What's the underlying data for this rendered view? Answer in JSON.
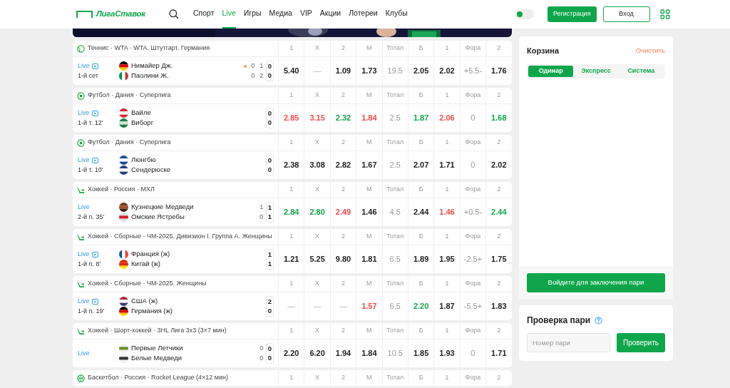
{
  "header": {
    "logo": "ЛигаСтавок",
    "nav": [
      {
        "label": "Спорт",
        "selected": false
      },
      {
        "label": "Live",
        "selected": true
      },
      {
        "label": "Игры",
        "selected": false
      },
      {
        "label": "Медиа",
        "selected": false
      },
      {
        "label": "VIP",
        "selected": false
      },
      {
        "label": "Акции",
        "selected": false
      },
      {
        "label": "Лотереи",
        "selected": false
      },
      {
        "label": "Клубы",
        "selected": false
      }
    ],
    "theme_switch": {
      "on": false
    },
    "register": "Регистрация",
    "login": "Вход"
  },
  "events": [
    {
      "kind": "tennis",
      "title": "Теннис · WTA · WTA. Штутгарт. Германия",
      "columns": [
        "1",
        "X",
        "2",
        "М",
        "Тотал",
        "Б",
        "1",
        "Фора",
        "2"
      ],
      "live": "Live",
      "video": true,
      "period": "1-й сет",
      "teams": [
        {
          "name": "Нимайер Дж.",
          "serving": true,
          "scores": [
            "0",
            "1"
          ],
          "current": "0"
        },
        {
          "name": "Паолини Ж.",
          "serving": false,
          "scores": [
            "0",
            "2"
          ],
          "current": "0"
        }
      ],
      "odds": [
        {
          "v": "5.40",
          "kind": "plain"
        },
        {
          "v": "—",
          "kind": "dash"
        },
        {
          "v": "1.09",
          "kind": "plain"
        },
        {
          "v": "1.73",
          "kind": "plain"
        },
        {
          "v": "19.5",
          "kind": "param"
        },
        {
          "v": "2.05",
          "kind": "plain"
        },
        {
          "v": "2.02",
          "kind": "plain"
        },
        {
          "v": "+5.5-",
          "kind": "param"
        },
        {
          "v": "1.76",
          "kind": "plain"
        }
      ]
    },
    {
      "kind": "football",
      "title": "Футбол · Дания · Суперлига",
      "columns": [
        "1",
        "X",
        "2",
        "М",
        "Тотал",
        "Б",
        "1",
        "Фора",
        "2"
      ],
      "live": "Live",
      "video": true,
      "period": "1-й т. 12'",
      "teams": [
        {
          "name": "Вайле",
          "current": "0"
        },
        {
          "name": "Виборг",
          "current": "0"
        }
      ],
      "odds": [
        {
          "v": "2.85",
          "kind": "down"
        },
        {
          "v": "3.15",
          "kind": "down"
        },
        {
          "v": "2.32",
          "kind": "up"
        },
        {
          "v": "1.84",
          "kind": "down"
        },
        {
          "v": "2.5",
          "kind": "param"
        },
        {
          "v": "1.87",
          "kind": "up"
        },
        {
          "v": "2.06",
          "kind": "down"
        },
        {
          "v": "0",
          "kind": "param"
        },
        {
          "v": "1.68",
          "kind": "up"
        }
      ]
    },
    {
      "kind": "football",
      "title": "Футбол · Дания · Суперлига",
      "columns": [
        "1",
        "X",
        "2",
        "М",
        "Тотал",
        "Б",
        "1",
        "Фора",
        "2"
      ],
      "live": "Live",
      "video": true,
      "period": "1-й т. 10'",
      "teams": [
        {
          "name": "Люнгбю",
          "current": "0"
        },
        {
          "name": "Сендерюске",
          "current": "0"
        }
      ],
      "odds": [
        {
          "v": "2.38",
          "kind": "plain"
        },
        {
          "v": "3.08",
          "kind": "plain"
        },
        {
          "v": "2.82",
          "kind": "plain"
        },
        {
          "v": "1.67",
          "kind": "plain"
        },
        {
          "v": "2.5",
          "kind": "param"
        },
        {
          "v": "2.07",
          "kind": "plain"
        },
        {
          "v": "1.71",
          "kind": "plain"
        },
        {
          "v": "0",
          "kind": "param"
        },
        {
          "v": "2.02",
          "kind": "plain"
        }
      ]
    },
    {
      "kind": "hockey",
      "title": "Хоккей · Россия · МХЛ",
      "columns": [
        "1",
        "X",
        "2",
        "М",
        "Тотал",
        "Б",
        "1",
        "Фора",
        "2"
      ],
      "live": "Live",
      "video": false,
      "period": "2-й п. 35'",
      "teams": [
        {
          "name": "Кузнецкие Медведи",
          "scores": [
            "1"
          ],
          "current": "1"
        },
        {
          "name": "Омские Ястребы",
          "scores": [
            "0"
          ],
          "current": "1"
        }
      ],
      "odds": [
        {
          "v": "2.84",
          "kind": "up"
        },
        {
          "v": "2.80",
          "kind": "up"
        },
        {
          "v": "2.49",
          "kind": "down"
        },
        {
          "v": "1.46",
          "kind": "plain"
        },
        {
          "v": "4.5",
          "kind": "param"
        },
        {
          "v": "2.44",
          "kind": "plain"
        },
        {
          "v": "1.46",
          "kind": "down"
        },
        {
          "v": "+0.5-",
          "kind": "param"
        },
        {
          "v": "2.44",
          "kind": "up"
        }
      ]
    },
    {
      "kind": "hockey",
      "title": "Хоккей · Сборные · ЧМ-2025. Дивизион I. Группа A. Женщины",
      "columns": [
        "1",
        "X",
        "2",
        "М",
        "Тотал",
        "Б",
        "1",
        "Фора",
        "2"
      ],
      "live": "Live",
      "video": true,
      "period": "1-й п. 8'",
      "teams": [
        {
          "name": "Франция (ж)",
          "current": "1"
        },
        {
          "name": "Китай (ж)",
          "current": "1"
        }
      ],
      "odds": [
        {
          "v": "1.21",
          "kind": "plain"
        },
        {
          "v": "5.25",
          "kind": "plain"
        },
        {
          "v": "9.80",
          "kind": "plain"
        },
        {
          "v": "1.81",
          "kind": "plain"
        },
        {
          "v": "6.5",
          "kind": "param"
        },
        {
          "v": "1.89",
          "kind": "plain"
        },
        {
          "v": "1.95",
          "kind": "plain"
        },
        {
          "v": "-2.5+",
          "kind": "param"
        },
        {
          "v": "1.75",
          "kind": "plain"
        }
      ]
    },
    {
      "kind": "hockey",
      "title": "Хоккей · Сборные · ЧМ-2025. Женщины",
      "columns": [
        "1",
        "X",
        "2",
        "М",
        "Тотал",
        "Б",
        "1",
        "Фора",
        "2"
      ],
      "live": "Live",
      "video": true,
      "period": "1-й п. 19'",
      "teams": [
        {
          "name": "США (ж)",
          "current": "2"
        },
        {
          "name": "Германия (ж)",
          "current": "0"
        }
      ],
      "odds": [
        {
          "v": "—",
          "kind": "dash"
        },
        {
          "v": "—",
          "kind": "dash"
        },
        {
          "v": "—",
          "kind": "dash"
        },
        {
          "v": "1.57",
          "kind": "down"
        },
        {
          "v": "6.5",
          "kind": "param"
        },
        {
          "v": "2.20",
          "kind": "up"
        },
        {
          "v": "1.87",
          "kind": "plain"
        },
        {
          "v": "-5.5+",
          "kind": "param"
        },
        {
          "v": "1.83",
          "kind": "plain"
        }
      ]
    },
    {
      "kind": "hockey",
      "title": "Хоккей · Шорт-хоккей · 3HL Лига 3х3 (3×7 мин)",
      "columns": [
        "1",
        "X",
        "2",
        "М",
        "Тотал",
        "Б",
        "1",
        "Фора",
        "2"
      ],
      "live": "Live",
      "video": false,
      "teams": [
        {
          "name": "Первые Летчики",
          "scores": [
            "0"
          ],
          "current": "0"
        },
        {
          "name": "Белые Медведи",
          "scores": [
            "0"
          ],
          "current": "0"
        }
      ],
      "odds": [
        {
          "v": "2.20",
          "kind": "plain"
        },
        {
          "v": "6.20",
          "kind": "plain"
        },
        {
          "v": "1.94",
          "kind": "plain"
        },
        {
          "v": "1.84",
          "kind": "plain"
        },
        {
          "v": "10.5",
          "kind": "param"
        },
        {
          "v": "1.85",
          "kind": "plain"
        },
        {
          "v": "1.93",
          "kind": "plain"
        },
        {
          "v": "0",
          "kind": "param"
        },
        {
          "v": "1.71",
          "kind": "plain"
        }
      ]
    },
    {
      "kind": "basketball",
      "title": "Баскетбол · Россия · Rocket League (4×12 мин)",
      "columns": [
        "1",
        "X",
        "2",
        "М",
        "Тотал",
        "Б",
        "1",
        "Фора",
        "2"
      ]
    }
  ],
  "basket": {
    "title": "Корзина",
    "clear": "Очистить",
    "tabs": [
      {
        "label": "Одинар",
        "selected": true
      },
      {
        "label": "Экспресс",
        "selected": false
      },
      {
        "label": "Система",
        "selected": false
      }
    ],
    "submit": "Войдите для заключения пари"
  },
  "check": {
    "title": "Проверка пари",
    "placeholder": "Номер пари",
    "button": "Проверить"
  }
}
